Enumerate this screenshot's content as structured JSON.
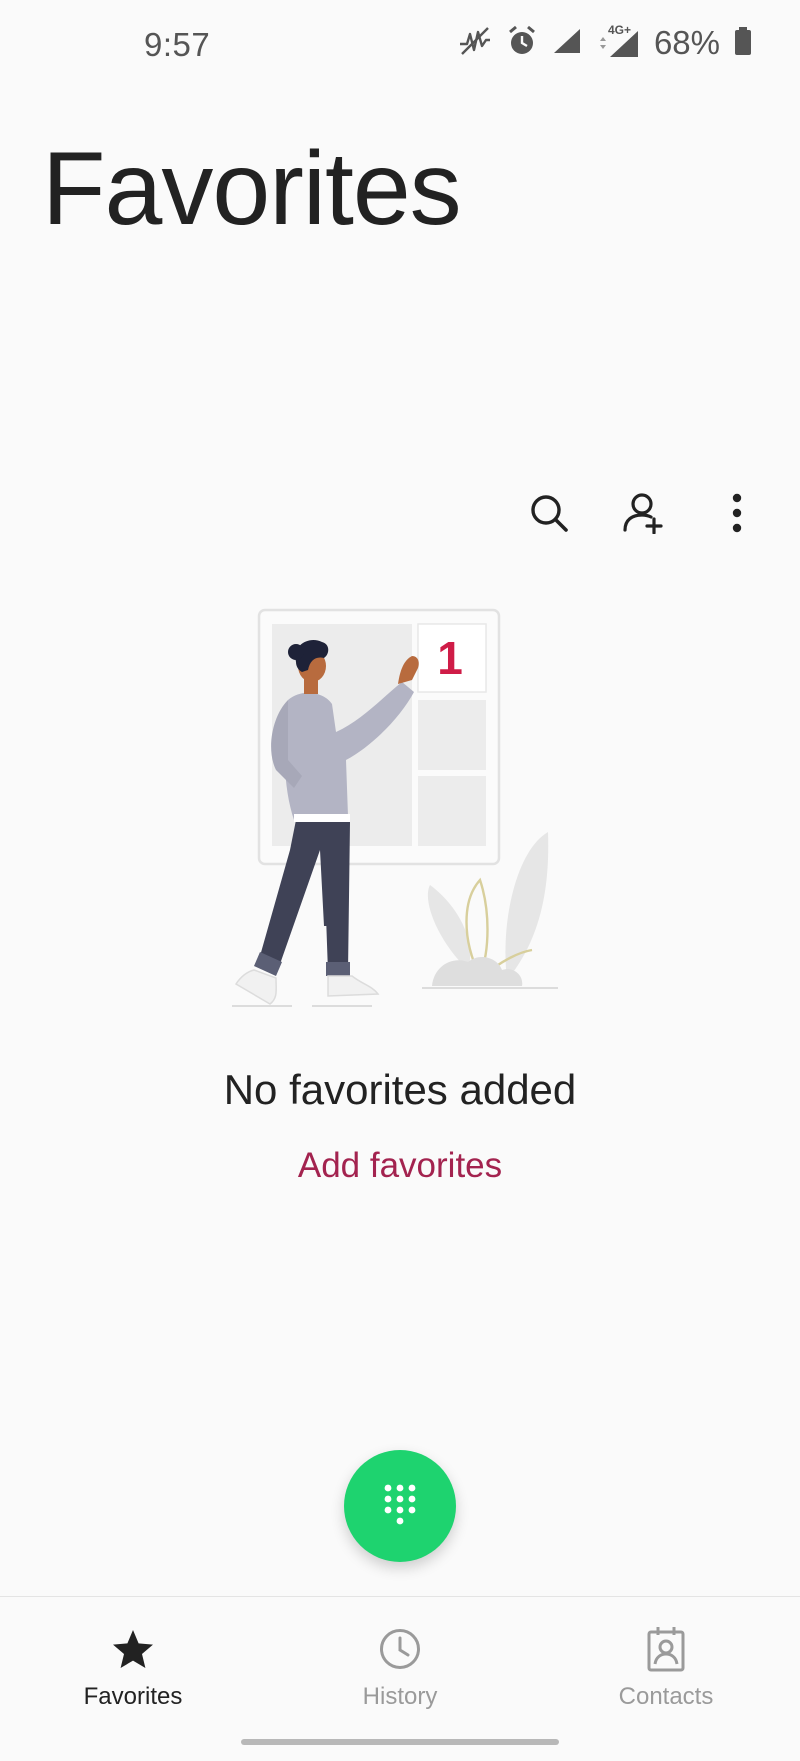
{
  "status_bar": {
    "time": "9:57",
    "battery_percent": "68%",
    "network_label": "4G+",
    "icons": [
      "no-data-icon",
      "alarm-icon",
      "signal-icon",
      "signal-4g-icon",
      "battery-icon"
    ]
  },
  "header": {
    "title": "Favorites"
  },
  "toolbar": {
    "icons": [
      "search-icon",
      "add-contact-icon",
      "more-options-icon"
    ]
  },
  "illustration": {
    "calendar_number": "1"
  },
  "empty_state": {
    "title": "No favorites added",
    "action_label": "Add favorites"
  },
  "fab": {
    "icon": "dialpad-icon"
  },
  "bottom_nav": {
    "items": [
      {
        "label": "Favorites",
        "icon": "star-icon",
        "active": true
      },
      {
        "label": "History",
        "icon": "clock-icon",
        "active": false
      },
      {
        "label": "Contacts",
        "icon": "contacts-icon",
        "active": false
      }
    ]
  },
  "colors": {
    "background": "#fafafa",
    "accent": "#a3234f",
    "fab": "#1ed36f",
    "text_primary": "#222222",
    "text_inactive": "#9a9a9a"
  }
}
